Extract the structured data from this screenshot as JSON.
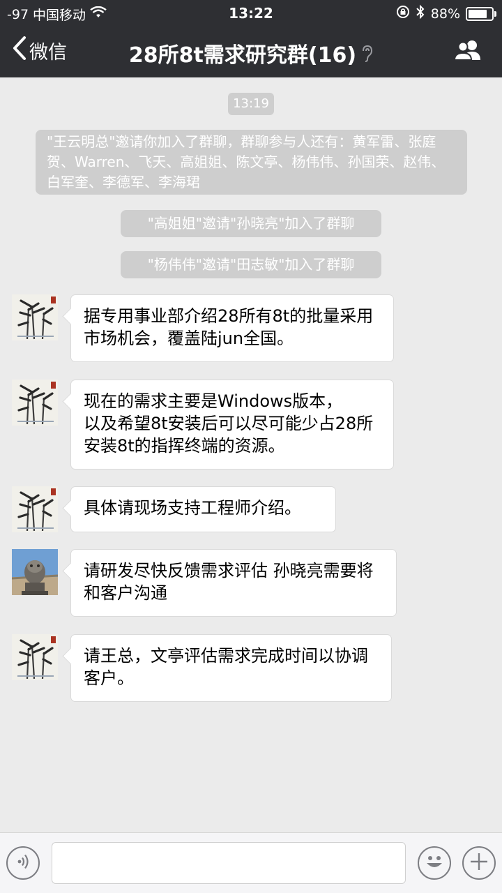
{
  "status_bar": {
    "signal": "-97",
    "carrier": "中国移动",
    "time": "13:22",
    "battery": "88%",
    "battery_level": 0.88
  },
  "nav": {
    "back_label": "微信",
    "title": "28所8t需求研究群(16)"
  },
  "chat": {
    "timestamp": "13:19",
    "system_messages": [
      "\"王云明总\"邀请你加入了群聊，群聊参与人还有：黄军雷、张庭贺、Warren、飞天、高姐姐、陈文亭、杨伟伟、孙国荣、赵伟、白军奎、李德军、李海珺",
      "\"高姐姐\"邀请\"孙晓亮\"加入了群聊",
      "\"杨伟伟\"邀请\"田志敏\"加入了群聊"
    ],
    "messages": [
      {
        "avatar": "bamboo-painting",
        "text": "据专用事业部介绍28所有8t的批量采用市场机会，覆盖陆jun全国。"
      },
      {
        "avatar": "bamboo-painting",
        "text": "现在的需求主要是Windows版本，\n以及希望8t安装后可以尽可能少占28所安装8t的指挥终端的资源。"
      },
      {
        "avatar": "bamboo-painting",
        "text": "具体请现场支持工程师介绍。"
      },
      {
        "avatar": "stone-lion-photo",
        "text": "请研发尽快反馈需求评估 孙晓亮需要将和客户沟通"
      },
      {
        "avatar": "bamboo-painting",
        "text": "请王总，文亭评估需求完成时间以协调客户。"
      }
    ]
  },
  "input_bar": {
    "placeholder": ""
  },
  "colors": {
    "header_bg": "#2e2f33",
    "chat_bg": "#ebebeb",
    "system_pill_bg": "#cecece",
    "bubble_bg": "#ffffff"
  }
}
